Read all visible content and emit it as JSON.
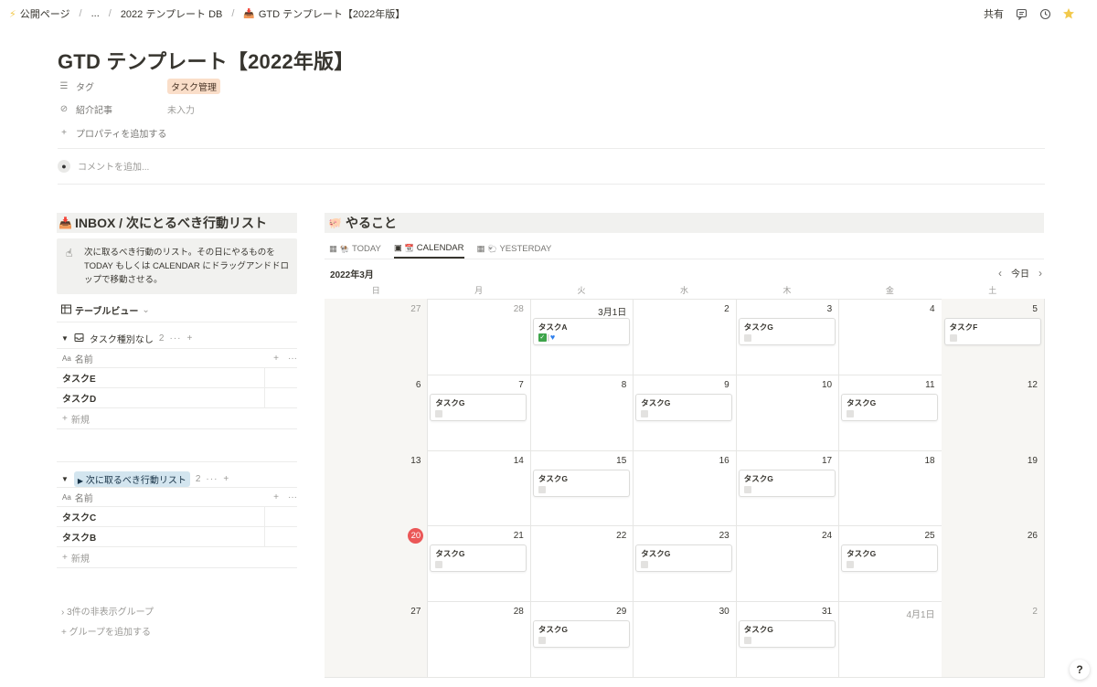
{
  "breadcrumb": {
    "items": [
      "公開ページ",
      "...",
      "2022 テンプレート DB",
      "GTD テンプレート【2022年版】"
    ],
    "icon_first": "lightning-icon",
    "icon_last": "inbox-tray-icon"
  },
  "topbar": {
    "share_label": "共有"
  },
  "page": {
    "title": "GTD テンプレート【2022年版】",
    "properties": [
      {
        "label": "タグ",
        "value": "タスク管理",
        "icon": "list-icon"
      },
      {
        "label": "紹介記事",
        "value": "未入力",
        "icon": "link-icon"
      }
    ],
    "add_property": "プロパティを追加する",
    "add_comment": "コメントを追加..."
  },
  "inbox": {
    "heading": "INBOX / 次にとるべき行動リスト",
    "callout_line1": "次に取るべき行動のリスト。その日にやるものを",
    "callout_line2": "TODAY もしくは CALENDAR にドラッグアンドドロ",
    "callout_line3": "ップで移動させる。",
    "view_label": "テーブルビュー",
    "groups": [
      {
        "name": "タスク種別なし",
        "count": "2",
        "column": "名前",
        "rows": [
          "タスクE",
          "タスクD"
        ],
        "new": "新規"
      },
      {
        "name": "次に取るべき行動リスト",
        "count": "2",
        "column": "名前",
        "rows": [
          "タスクC",
          "タスクB"
        ],
        "new": "新規"
      }
    ],
    "hidden_groups": "3件の非表示グループ",
    "add_group": "グループを追加する"
  },
  "todo": {
    "heading": "やること",
    "tabs": [
      "TODAY",
      "CALENDAR",
      "YESTERDAY"
    ],
    "active_tab": "CALENDAR",
    "month": "2022年3月",
    "today_label": "今日",
    "weekdays": [
      "日",
      "月",
      "火",
      "水",
      "木",
      "金",
      "土"
    ],
    "weeks": [
      [
        {
          "d": "27",
          "m": true
        },
        {
          "d": "28",
          "m": true
        },
        {
          "d": "3月1日",
          "card": "タスクA",
          "emoji": true
        },
        {
          "d": "2"
        },
        {
          "d": "3",
          "card": "タスクG"
        },
        {
          "d": "4"
        },
        {
          "d": "5",
          "card": "タスクF"
        }
      ],
      [
        {
          "d": "6"
        },
        {
          "d": "7",
          "card": "タスクG"
        },
        {
          "d": "8"
        },
        {
          "d": "9",
          "card": "タスクG"
        },
        {
          "d": "10"
        },
        {
          "d": "11",
          "card": "タスクG"
        },
        {
          "d": "12"
        }
      ],
      [
        {
          "d": "13"
        },
        {
          "d": "14"
        },
        {
          "d": "15",
          "card": "タスクG"
        },
        {
          "d": "16"
        },
        {
          "d": "17",
          "card": "タスクG"
        },
        {
          "d": "18"
        },
        {
          "d": "19"
        }
      ],
      [
        {
          "d": "20",
          "today": true
        },
        {
          "d": "21",
          "card": "タスクG"
        },
        {
          "d": "22"
        },
        {
          "d": "23",
          "card": "タスクG"
        },
        {
          "d": "24"
        },
        {
          "d": "25",
          "card": "タスクG"
        },
        {
          "d": "26"
        }
      ],
      [
        {
          "d": "27"
        },
        {
          "d": "28"
        },
        {
          "d": "29",
          "card": "タスクG"
        },
        {
          "d": "30"
        },
        {
          "d": "31",
          "card": "タスクG"
        },
        {
          "d": "4月1日",
          "m": true
        },
        {
          "d": "2",
          "m": true
        }
      ]
    ]
  },
  "help_label": "?"
}
